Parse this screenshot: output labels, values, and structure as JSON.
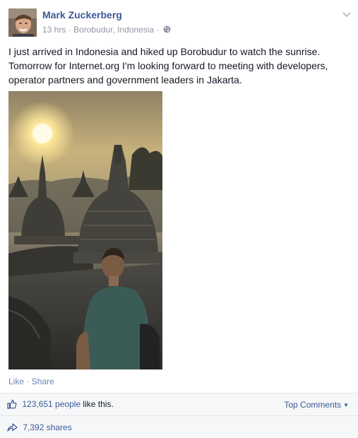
{
  "post": {
    "author": "Mark Zuckerberg",
    "time": "13 hrs",
    "location": "Borobudur, Indonesia",
    "dot": "·",
    "text": "I just arrived in Indonesia and hiked up Borobudur to watch the sunrise. Tomorrow for Internet.org I'm looking forward to meeting with developers, operator partners and government leaders in Jakarta.",
    "privacy_icon": "globe-icon",
    "menu_icon": "chevron-down-icon"
  },
  "actions": {
    "like_label": "Like",
    "separator": "·",
    "share_label": "Share"
  },
  "ufi": {
    "like_count": "123,651 people",
    "like_suffix": " like this.",
    "top_comments_label": "Top Comments",
    "shares_label": "7,392 shares"
  },
  "colors": {
    "link": "#3b5998",
    "action_link": "#6d84b4",
    "meta": "#9197a3",
    "ufi_background": "#f6f7f8"
  }
}
